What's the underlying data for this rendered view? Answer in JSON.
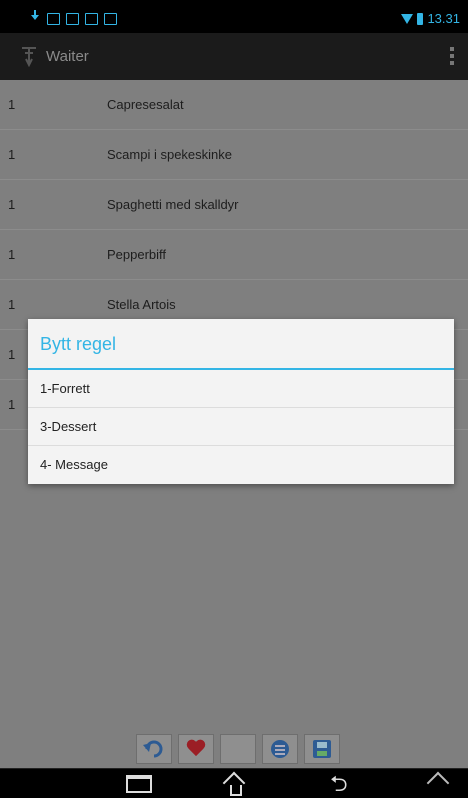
{
  "status_bar": {
    "time": "13.31",
    "icons": [
      "download-icon",
      "update-icon",
      "image-icon",
      "bag-icon",
      "briefcase-icon"
    ]
  },
  "action_bar": {
    "title": "Waiter",
    "logo_icon": "waiter-logo-icon",
    "menu_icon": "overflow-menu-icon"
  },
  "list": {
    "rows": [
      {
        "qty": "1",
        "name": "Capresesalat"
      },
      {
        "qty": "1",
        "name": "Scampi i spekeskinke"
      },
      {
        "qty": "1",
        "name": "Spaghetti med skalldyr"
      },
      {
        "qty": "1",
        "name": "Pepperbiff"
      },
      {
        "qty": "1",
        "name": "Stella Artois"
      },
      {
        "qty": "1",
        "name": ""
      },
      {
        "qty": "1",
        "name": ""
      }
    ]
  },
  "dialog": {
    "title": "Bytt regel",
    "options": [
      "1-Forrett",
      "3-Dessert",
      "4- Message"
    ]
  },
  "toolbar": {
    "buttons": [
      "undo-icon",
      "heart-icon",
      "blank",
      "list-icon",
      "save-icon"
    ]
  },
  "colors": {
    "accent": "#33b5e5",
    "dim_background": "#7f7f7f",
    "dialog_background": "#f3f3f3"
  }
}
